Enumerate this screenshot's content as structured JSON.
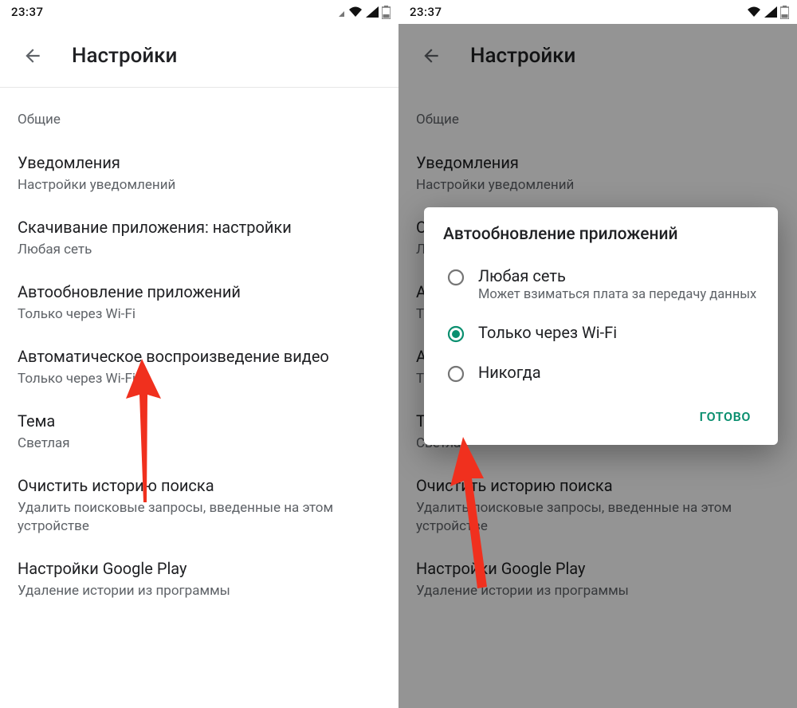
{
  "status": {
    "time": "23:37"
  },
  "appbar": {
    "title": "Настройки"
  },
  "sections": {
    "general": "Общие"
  },
  "items": {
    "notifications": {
      "title": "Уведомления",
      "sub": "Настройки уведомлений"
    },
    "download": {
      "title": "Скачивание приложения: настройки",
      "sub": "Любая сеть"
    },
    "autoupdate": {
      "title": "Автообновление приложений",
      "sub": "Только через Wi-Fi"
    },
    "autoplay": {
      "title": "Автоматическое воспроизведение видео",
      "sub": "Только через Wi-Fi"
    },
    "theme": {
      "title": "Тема",
      "sub": "Светлая"
    },
    "clearhistory": {
      "title": "Очистить историю поиска",
      "sub": "Удалить поисковые запросы, введенные на этом устройстве"
    },
    "gplay": {
      "title": "Настройки Google Play",
      "sub": "Удаление истории из программы"
    }
  },
  "dialog": {
    "title": "Автообновление приложений",
    "options": {
      "any": {
        "label": "Любая сеть",
        "sub": "Может взиматься плата за передачу данных"
      },
      "wifi": {
        "label": "Только через Wi-Fi"
      },
      "never": {
        "label": "Никогда"
      }
    },
    "done": "Готово"
  },
  "colors": {
    "accent": "#0a8f6f",
    "arrow": "#f0301e"
  }
}
